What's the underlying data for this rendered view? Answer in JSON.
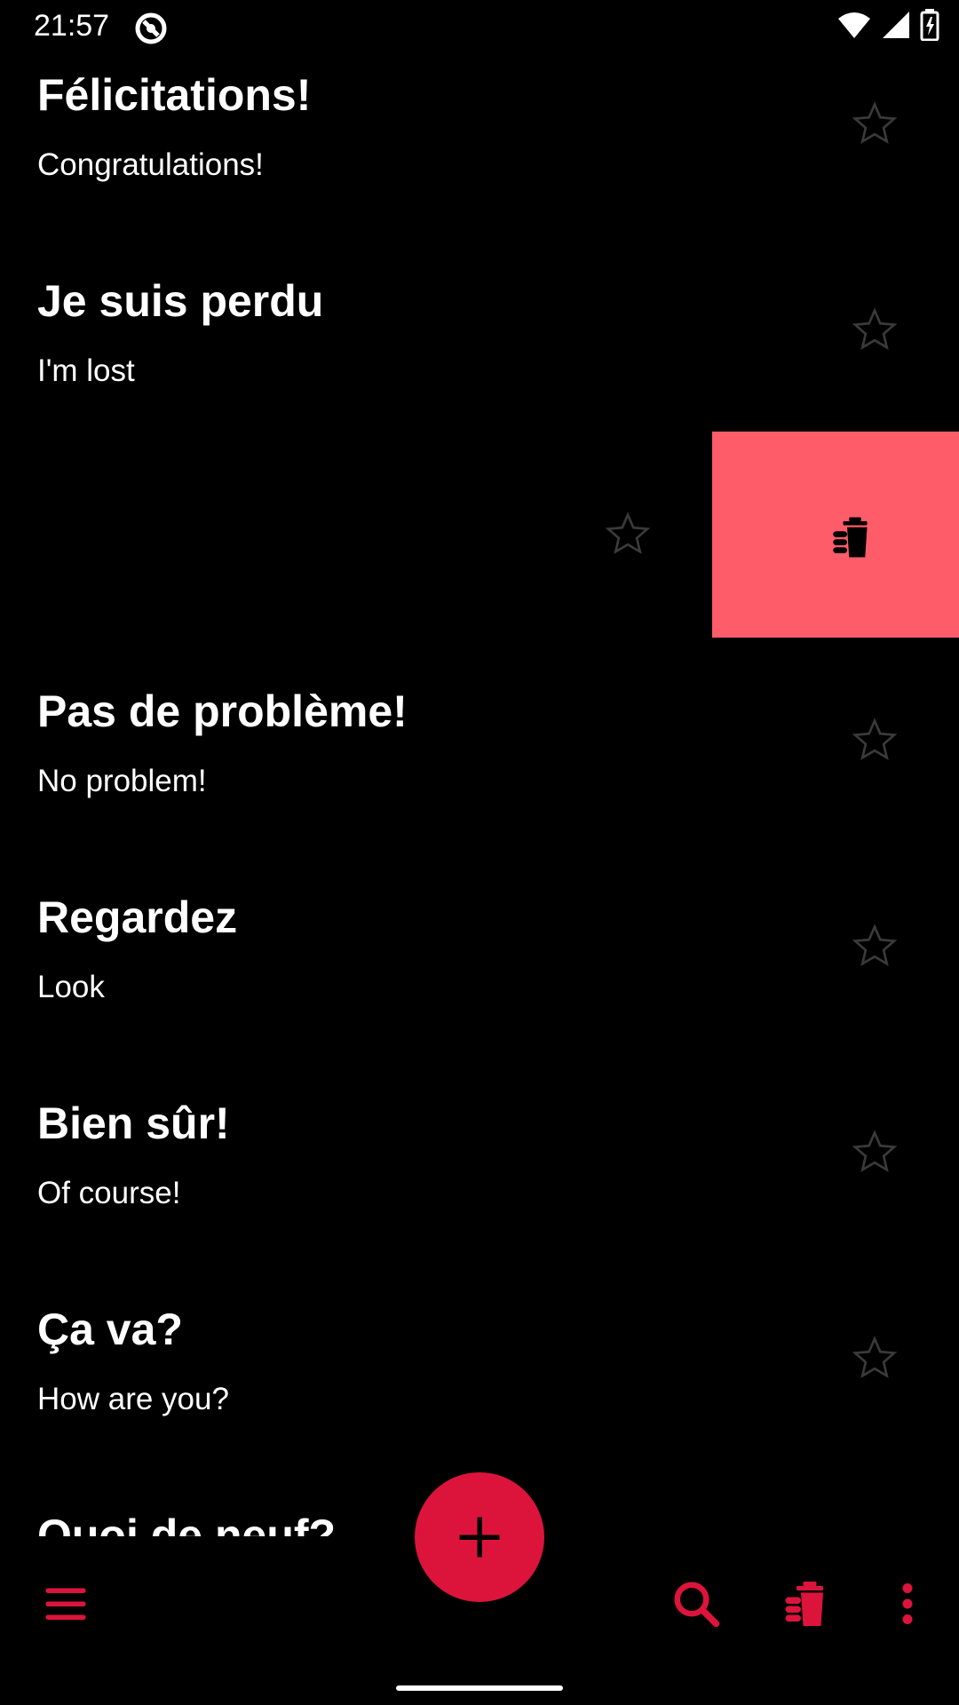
{
  "status_bar": {
    "time": "21:57"
  },
  "phrases": [
    {
      "french": "Félicitations!",
      "english": "Congratulations!"
    },
    {
      "french": "Je suis perdu",
      "english": "I'm lost"
    },
    {
      "french": "",
      "english": "",
      "swiped": true
    },
    {
      "french": "Pas de problème!",
      "english": "No problem!"
    },
    {
      "french": "Regardez",
      "english": "Look"
    },
    {
      "french": "Bien sûr!",
      "english": "Of course!"
    },
    {
      "french": "Ça va?",
      "english": "How are you?"
    },
    {
      "french": "Quoi de neuf?",
      "english": ""
    }
  ],
  "icons": {
    "menu": "menu-icon",
    "search": "search-icon",
    "delete_all": "delete-sweep-icon",
    "more": "more-vert-icon",
    "add": "plus-icon",
    "star": "star-outline-icon"
  },
  "colors": {
    "accent": "#dc143c",
    "delete_background": "#ff5c6a",
    "star_outline": "#3a3a3a",
    "background": "#000000"
  }
}
